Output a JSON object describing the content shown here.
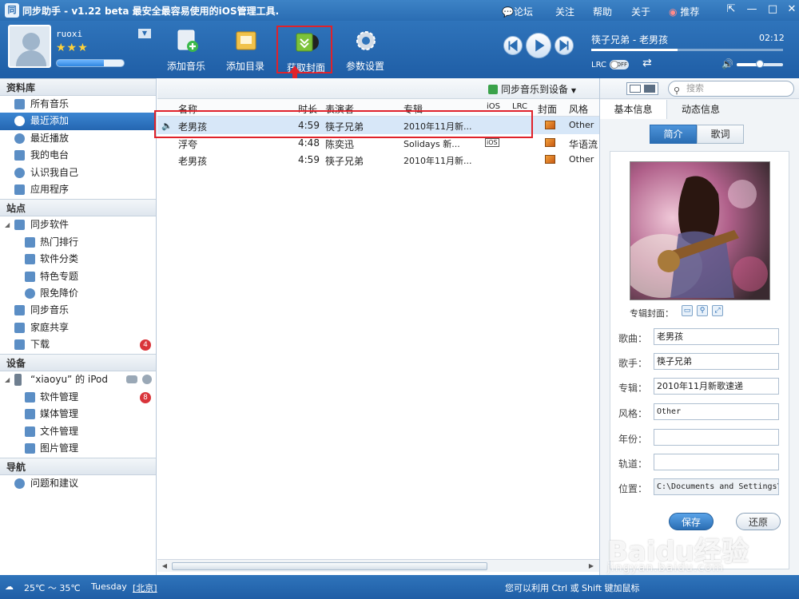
{
  "app": {
    "title": "同步助手 - v1.22 beta  最安全最容易使用的iOS管理工具.",
    "links": [
      {
        "label": "论坛"
      },
      {
        "label": "关注"
      },
      {
        "label": "帮助"
      },
      {
        "label": "关于"
      },
      {
        "label": "推荐"
      }
    ]
  },
  "user": {
    "name": "ruoxi",
    "stars": "★★★",
    "level_fraction": 0.7
  },
  "toolbar": {
    "add_music": "添加音乐",
    "add_folder": "添加目录",
    "get_cover": "获取封面",
    "settings": "参数设置"
  },
  "player": {
    "now_playing": "筷子兄弟 - 老男孩",
    "time": "02:12",
    "lrc_label": "LRC",
    "lrc_state": "OFF",
    "progress_fraction": 0.45,
    "volume_fraction": 0.5
  },
  "sidebar": {
    "library": {
      "title": "资料库",
      "items": [
        {
          "label": "所有音乐"
        },
        {
          "label": "最近添加"
        },
        {
          "label": "最近播放"
        },
        {
          "label": "我的电台"
        },
        {
          "label": "认识我自己"
        },
        {
          "label": "应用程序"
        }
      ]
    },
    "sites": {
      "title": "站点",
      "items": [
        {
          "label": "同步软件"
        },
        {
          "label": "热门排行"
        },
        {
          "label": "软件分类"
        },
        {
          "label": "特色专题"
        },
        {
          "label": "限免降价"
        },
        {
          "label": "同步音乐"
        },
        {
          "label": "家庭共享"
        },
        {
          "label": "下载",
          "badge": "4"
        }
      ]
    },
    "devices": {
      "title": "设备",
      "device_name": "“xiaoyu” 的 iPod",
      "items": [
        {
          "label": "软件管理",
          "badge": "8"
        },
        {
          "label": "媒体管理"
        },
        {
          "label": "文件管理"
        },
        {
          "label": "图片管理"
        }
      ]
    },
    "nav": {
      "title": "导航",
      "items": [
        {
          "label": "问题和建议"
        }
      ]
    }
  },
  "main": {
    "sync_label": "同步音乐到设备",
    "columns": {
      "name": "名称",
      "duration": "时长",
      "artist": "表演者",
      "album": "专辑",
      "ios": "iOS",
      "lrc": "LRC",
      "cover": "封面",
      "genre": "风格"
    },
    "rows": [
      {
        "name": "老男孩",
        "duration": "4:59",
        "artist": "筷子兄弟",
        "album": "2010年11月新...",
        "ios": "",
        "genre": "Other"
      },
      {
        "name": "浮夸",
        "duration": "4:48",
        "artist": "陈奕迅",
        "album": "Solidays 新...",
        "ios": "iOS",
        "genre": "华语流"
      },
      {
        "name": "老男孩",
        "duration": "4:59",
        "artist": "筷子兄弟",
        "album": "2010年11月新...",
        "ios": "",
        "genre": "Other"
      }
    ]
  },
  "right": {
    "search_placeholder": "搜索",
    "tabs": {
      "basic": "基本信息",
      "dynamic": "动态信息"
    },
    "subtabs": {
      "intro": "简介",
      "lyrics": "歌词"
    },
    "cover_label": "专辑封面：",
    "fields": {
      "song_label": "歌曲：",
      "song": "老男孩",
      "artist_label": "歌手：",
      "artist": "筷子兄弟",
      "album_label": "专辑：",
      "album": "2010年11月新歌速递",
      "genre_label": "风格：",
      "genre": "Other",
      "year_label": "年份：",
      "year": "",
      "track_label": "轨道：",
      "track": "",
      "location_label": "位置：",
      "location": "C:\\Documents and Settings\\"
    },
    "save": "保存",
    "restore": "还原"
  },
  "status": {
    "weather": "25℃ ～ 35℃",
    "day": "Tuesday",
    "city": "[北京]",
    "hint": "您可以利用 Ctrl 或 Shift 键加鼠标"
  },
  "watermark": {
    "brand": "Baidu经验",
    "url": "jingyan.baidu.com"
  }
}
